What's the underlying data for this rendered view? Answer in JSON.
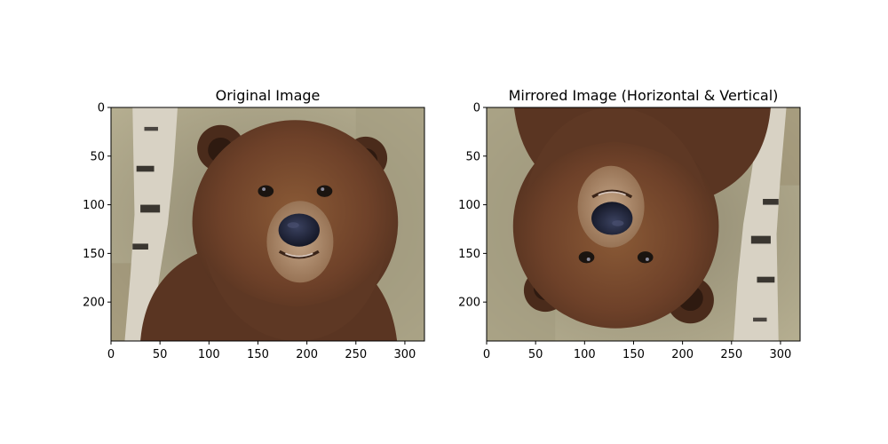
{
  "chart_data": [
    {
      "type": "image",
      "title": "Original Image",
      "orientation": "normal",
      "xlim": [
        0,
        320
      ],
      "ylim": [
        240,
        0
      ],
      "xticks": [
        0,
        50,
        100,
        150,
        200,
        250,
        300
      ],
      "yticks": [
        0,
        50,
        100,
        150,
        200
      ],
      "grid": false,
      "colors": {
        "background": "#b3ab8f",
        "fur_dark": "#4f2f1e",
        "fur": "#6e4129",
        "fur_light": "#8a5a36",
        "muzzle": "#b59476",
        "nose": "#1f2438",
        "birch": "#d8d2c4"
      }
    },
    {
      "type": "image",
      "title": "Mirrored Image (Horizontal & Vertical)",
      "orientation": "flipped-both",
      "xlim": [
        0,
        320
      ],
      "ylim": [
        240,
        0
      ],
      "xticks": [
        0,
        50,
        100,
        150,
        200,
        250,
        300
      ],
      "yticks": [
        0,
        50,
        100,
        150,
        200
      ],
      "grid": false,
      "colors": {
        "background": "#b3ab8f",
        "fur_dark": "#4f2f1e",
        "fur": "#6e4129",
        "fur_light": "#8a5a36",
        "muzzle": "#b59476",
        "nose": "#1f2438",
        "birch": "#d8d2c4"
      }
    }
  ]
}
